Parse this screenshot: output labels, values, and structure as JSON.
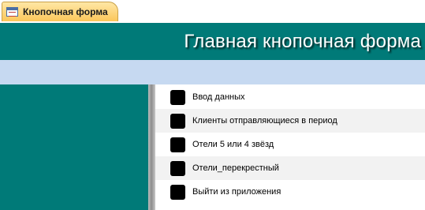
{
  "tab": {
    "label": "Кнопочная форма",
    "icon": "form-icon"
  },
  "header": {
    "title": "Главная кнопочная форма"
  },
  "colors": {
    "teal": "#007a78",
    "subband": "#c6d9f1",
    "tab": "#fbc65a"
  },
  "menu": {
    "items": [
      {
        "label": "Ввод данных"
      },
      {
        "label": "Клиенты отправляющиеся в период"
      },
      {
        "label": "Отели 5 или 4 звёзд"
      },
      {
        "label": "Отели_перекрестный"
      },
      {
        "label": "Выйти из приложения"
      }
    ]
  }
}
